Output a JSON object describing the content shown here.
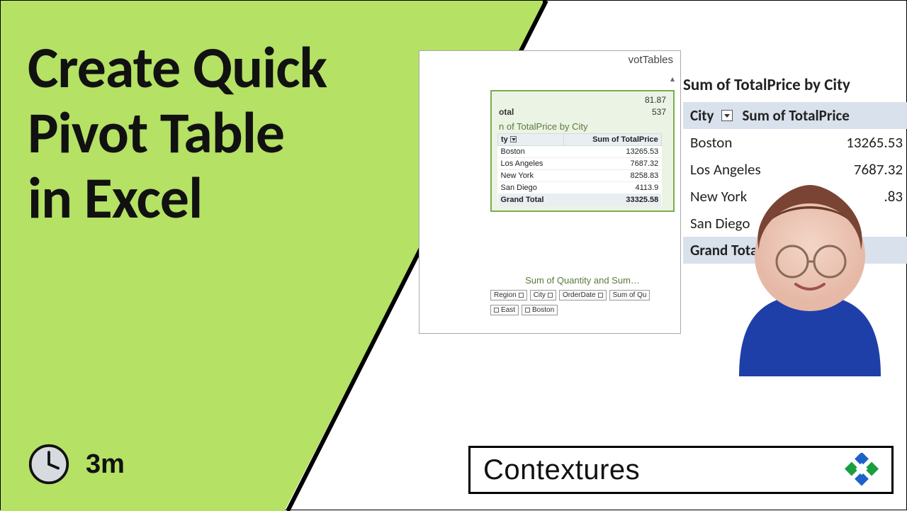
{
  "title_lines": [
    "Create Quick",
    "Pivot Table",
    "in Excel"
  ],
  "duration": "3m",
  "dialog": {
    "tab_label": "votTables",
    "top_rows": [
      {
        "label": "",
        "value": "81.87"
      },
      {
        "label": "otal",
        "value": "537"
      }
    ],
    "preview_title": "n of TotalPrice by City",
    "col_city": "ty",
    "col_value": "Sum of TotalPrice",
    "rows": [
      {
        "city": "Boston",
        "val": "13265.53"
      },
      {
        "city": "Los Angeles",
        "val": "7687.32"
      },
      {
        "city": "New York",
        "val": "8258.83"
      },
      {
        "city": "San Diego",
        "val": "4113.9"
      }
    ],
    "grand_label": "Grand Total",
    "grand_value": "33325.58",
    "below_caption": "Sum of Quantity and Sum…",
    "fields": [
      "Region",
      "City",
      "OrderDate",
      "Sum of Qu"
    ],
    "filters": [
      {
        "k": "East"
      },
      {
        "k": "Boston"
      }
    ]
  },
  "bigpivot": {
    "title": "Sum of TotalPrice by City",
    "col_city": "City",
    "col_value": "Sum of TotalPrice",
    "rows": [
      {
        "city": "Boston",
        "val": "13265.53"
      },
      {
        "city": "Los Angeles",
        "val": "7687.32"
      },
      {
        "city": "New York",
        "val": ".83"
      },
      {
        "city": "San Diego",
        "val": ""
      }
    ],
    "grand": "Grand Total"
  },
  "brand": "Contextures",
  "chart_data": {
    "type": "table",
    "title": "Sum of TotalPrice by City",
    "categories": [
      "Boston",
      "Los Angeles",
      "New York",
      "San Diego"
    ],
    "values": [
      13265.53,
      7687.32,
      8258.83,
      4113.9
    ],
    "grand_total": 33325.58,
    "xlabel": "City",
    "ylabel": "Sum of TotalPrice"
  }
}
